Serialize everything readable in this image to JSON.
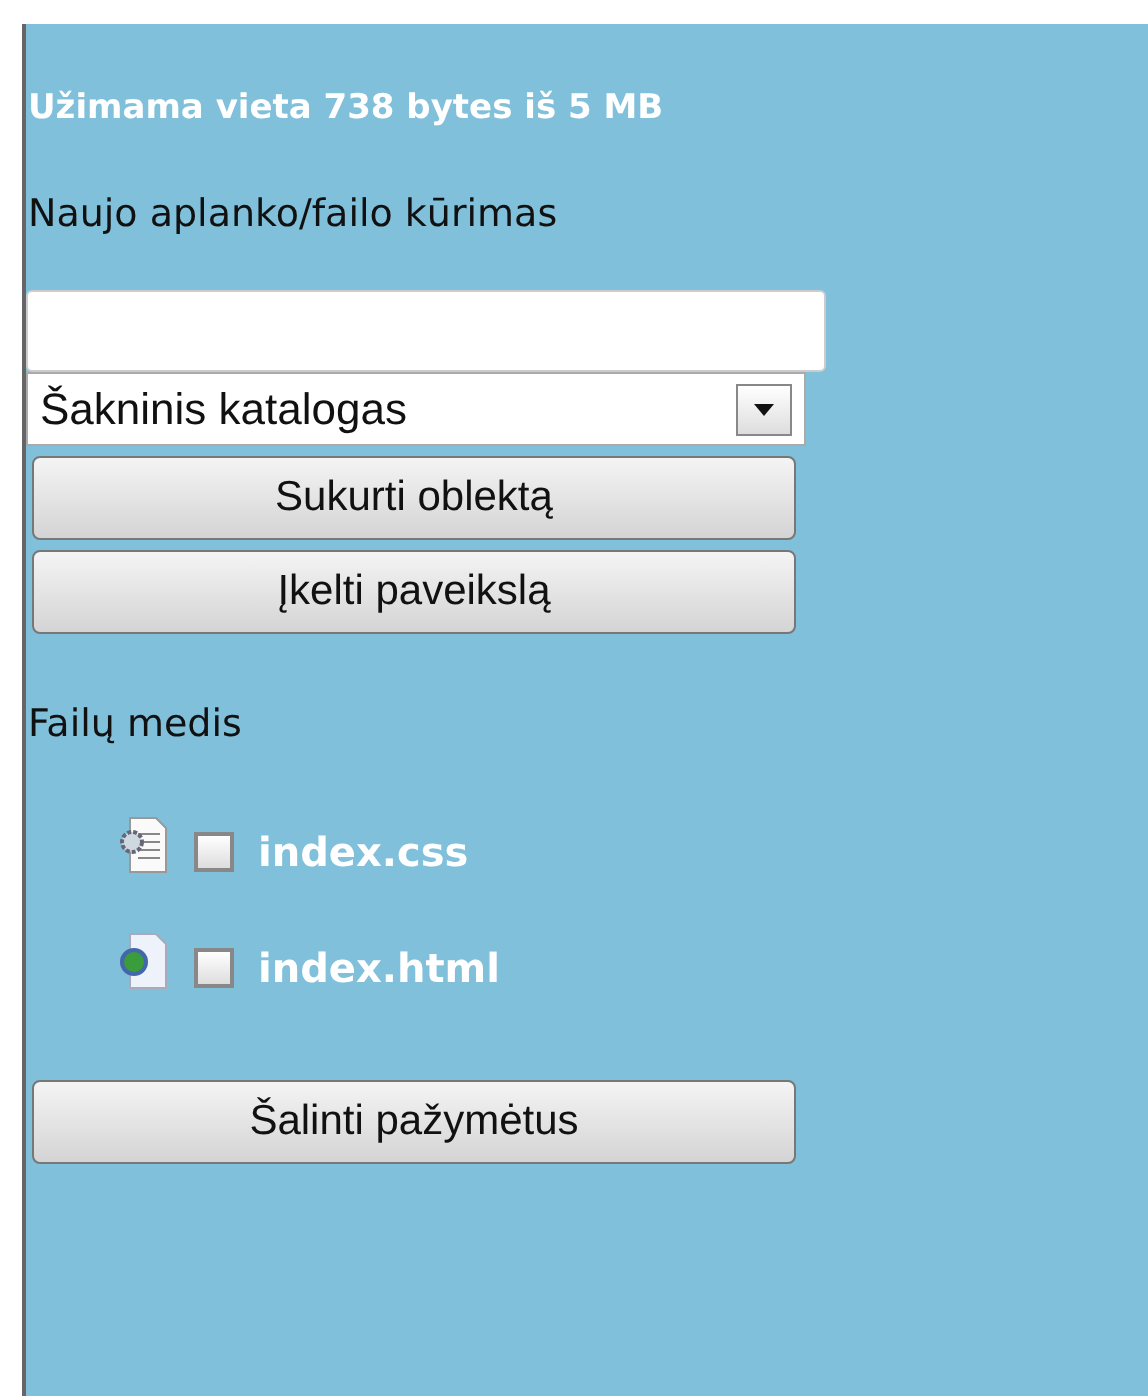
{
  "storage": "Užimama vieta 738 bytes iš 5 MB",
  "create_heading": "Naujo aplanko/failo kūrimas",
  "folder_select": {
    "value": "Šakninis katalogas"
  },
  "create_buttons": [
    "Sukurti oblektą",
    "Įkelti paveikslą"
  ],
  "tree_heading": "Failų medis",
  "files": [
    {
      "name": "index.css",
      "kind": "css",
      "checked": false
    },
    {
      "name": "index.html",
      "kind": "html",
      "checked": false
    }
  ],
  "delete_button": "Šalinti pažymėtus"
}
